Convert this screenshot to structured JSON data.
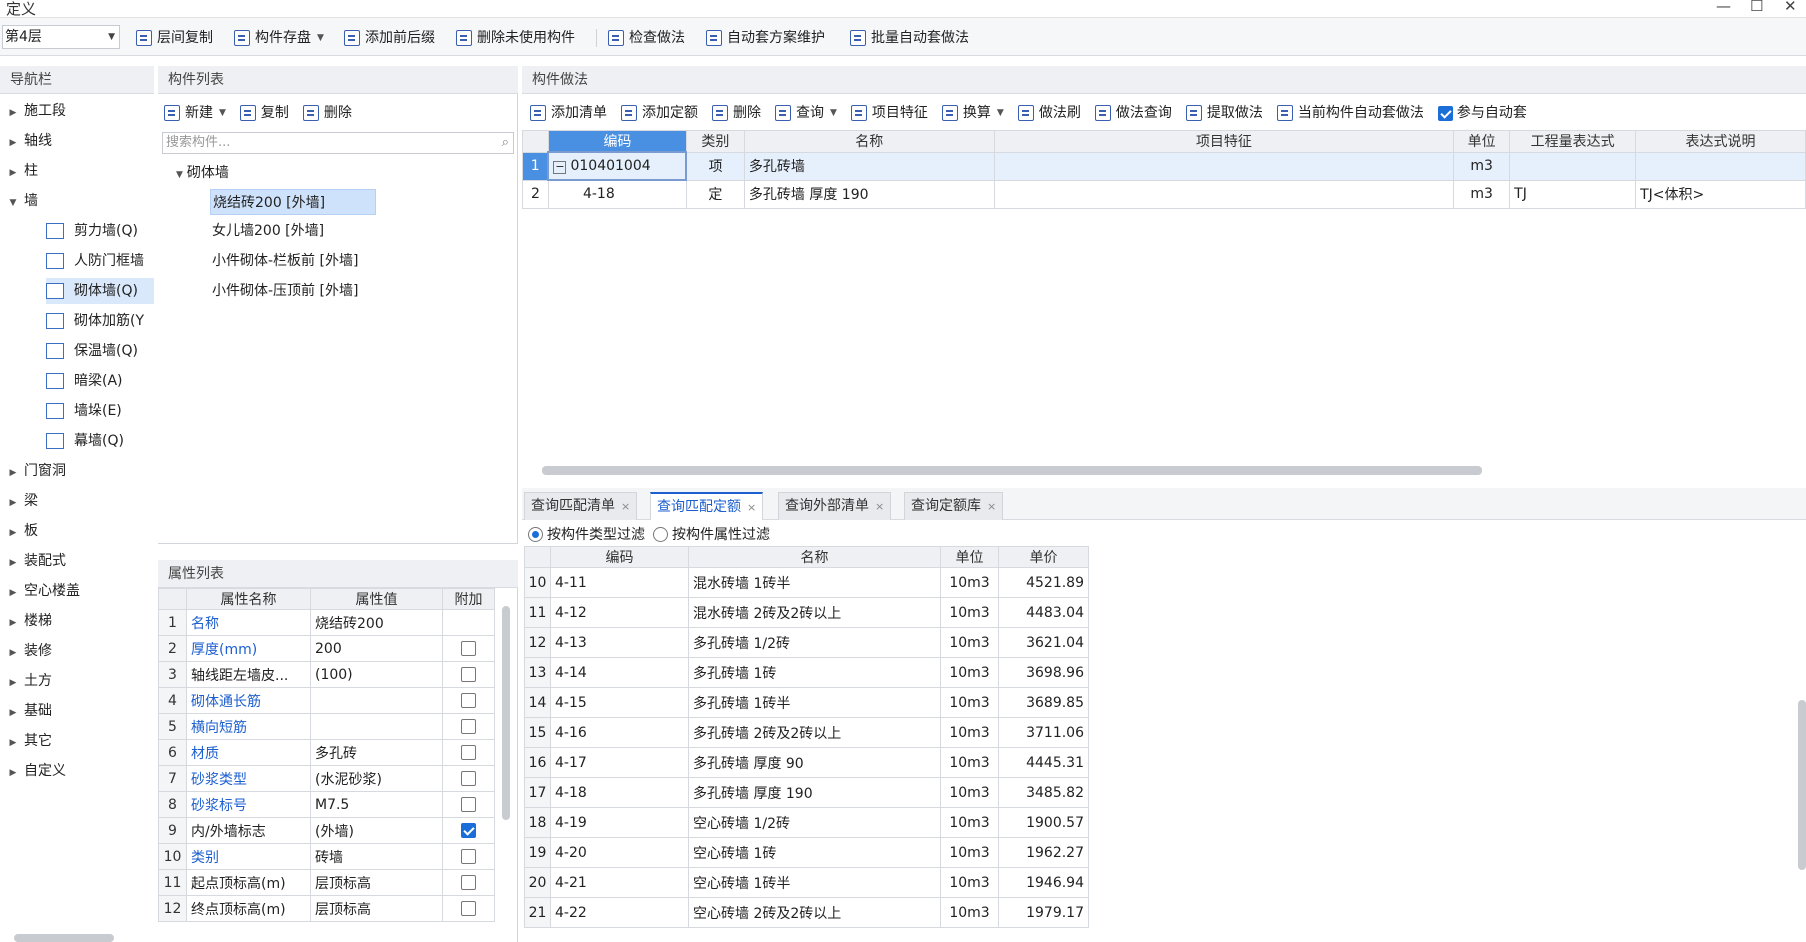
{
  "window": {
    "title": "定义",
    "min": "—",
    "max": "☐",
    "close": "✕"
  },
  "toolbar": {
    "layer": "第4层",
    "buttons": [
      "层间复制",
      "构件存盘",
      "添加前后缀",
      "删除未使用构件",
      "检查做法",
      "自动套方案维护",
      "批量自动套做法"
    ]
  },
  "nav": {
    "title": "导航栏",
    "top_items": [
      "施工段",
      "轴线",
      "柱",
      "墙"
    ],
    "wall_children": [
      "剪力墙(Q)",
      "人防门框墙",
      "砌体墙(Q)",
      "砌体加筋(Y",
      "保温墙(Q)",
      "暗梁(A)",
      "墙垛(E)",
      "幕墙(Q)"
    ],
    "bottom_items": [
      "门窗洞",
      "梁",
      "板",
      "装配式",
      "空心楼盖",
      "楼梯",
      "装修",
      "土方",
      "基础",
      "其它",
      "自定义"
    ]
  },
  "complist": {
    "title": "构件列表",
    "new_label": "新建",
    "copy_label": "复制",
    "delete_label": "删除",
    "search_placeholder": "搜索构件...",
    "group": "砌体墙",
    "items": [
      "烧结砖200 [外墙]",
      "女儿墙200 [外墙]",
      "小件砌体-栏板前 [外墙]",
      "小件砌体-压顶前 [外墙]"
    ]
  },
  "props": {
    "title": "属性列表",
    "headers": [
      "属性名称",
      "属性值",
      "附加"
    ],
    "rows": [
      {
        "n": "1",
        "name": "名称",
        "value": "烧结砖200",
        "blue": true,
        "cb": null
      },
      {
        "n": "2",
        "name": "厚度(mm)",
        "value": "200",
        "blue": true,
        "cb": false
      },
      {
        "n": "3",
        "name": "轴线距左墙皮...",
        "value": "(100)",
        "blue": false,
        "cb": false
      },
      {
        "n": "4",
        "name": "砌体通长筋",
        "value": "",
        "blue": true,
        "cb": false
      },
      {
        "n": "5",
        "name": "横向短筋",
        "value": "",
        "blue": true,
        "cb": false
      },
      {
        "n": "6",
        "name": "材质",
        "value": "多孔砖",
        "blue": true,
        "cb": false
      },
      {
        "n": "7",
        "name": "砂浆类型",
        "value": "(水泥砂浆)",
        "blue": true,
        "cb": false
      },
      {
        "n": "8",
        "name": "砂浆标号",
        "value": "M7.5",
        "blue": true,
        "cb": false
      },
      {
        "n": "9",
        "name": "内/外墙标志",
        "value": "(外墙)",
        "blue": false,
        "cb": true
      },
      {
        "n": "10",
        "name": "类别",
        "value": "砖墙",
        "blue": true,
        "cb": false
      },
      {
        "n": "11",
        "name": "起点顶标高(m)",
        "value": "层顶标高",
        "blue": false,
        "cb": false
      },
      {
        "n": "12",
        "name": "终点顶标高(m)",
        "value": "层顶标高",
        "blue": false,
        "cb": false
      }
    ]
  },
  "method": {
    "title": "构件做法",
    "buttons": [
      "添加清单",
      "添加定额",
      "删除",
      "查询",
      "项目特征",
      "换算",
      "做法刷",
      "做法查询",
      "提取做法",
      "当前构件自动套做法"
    ],
    "auto_label": "参与自动套",
    "headers": [
      "编码",
      "类别",
      "名称",
      "项目特征",
      "单位",
      "工程量表达式",
      "表达式说明"
    ],
    "rows": [
      {
        "n": "1",
        "code": "010401004",
        "type": "项",
        "name": "多孔砖墙",
        "feature": "",
        "unit": "m3",
        "expr": "",
        "desc": ""
      },
      {
        "n": "2",
        "code": "4-18",
        "type": "定",
        "name": "多孔砖墙 厚度 190",
        "feature": "",
        "unit": "m3",
        "expr": "TJ",
        "desc": "TJ<体积>"
      }
    ]
  },
  "query": {
    "tabs": [
      "查询匹配清单",
      "查询匹配定额",
      "查询外部清单",
      "查询定额库"
    ],
    "filter_type": "按构件类型过滤",
    "filter_attr": "按构件属性过滤",
    "headers": [
      "编码",
      "名称",
      "单位",
      "单价"
    ],
    "rows": [
      {
        "n": "10",
        "code": "4-11",
        "name": "混水砖墙 1砖半",
        "unit": "10m3",
        "price": "4521.89"
      },
      {
        "n": "11",
        "code": "4-12",
        "name": "混水砖墙 2砖及2砖以上",
        "unit": "10m3",
        "price": "4483.04"
      },
      {
        "n": "12",
        "code": "4-13",
        "name": "多孔砖墙 1/2砖",
        "unit": "10m3",
        "price": "3621.04"
      },
      {
        "n": "13",
        "code": "4-14",
        "name": "多孔砖墙 1砖",
        "unit": "10m3",
        "price": "3698.96"
      },
      {
        "n": "14",
        "code": "4-15",
        "name": "多孔砖墙 1砖半",
        "unit": "10m3",
        "price": "3689.85"
      },
      {
        "n": "15",
        "code": "4-16",
        "name": "多孔砖墙 2砖及2砖以上",
        "unit": "10m3",
        "price": "3711.06"
      },
      {
        "n": "16",
        "code": "4-17",
        "name": "多孔砖墙 厚度 90",
        "unit": "10m3",
        "price": "4445.31"
      },
      {
        "n": "17",
        "code": "4-18",
        "name": "多孔砖墙 厚度 190",
        "unit": "10m3",
        "price": "3485.82"
      },
      {
        "n": "18",
        "code": "4-19",
        "name": "空心砖墙 1/2砖",
        "unit": "10m3",
        "price": "1900.57"
      },
      {
        "n": "19",
        "code": "4-20",
        "name": "空心砖墙 1砖",
        "unit": "10m3",
        "price": "1962.27"
      },
      {
        "n": "20",
        "code": "4-21",
        "name": "空心砖墙 1砖半",
        "unit": "10m3",
        "price": "1946.94"
      },
      {
        "n": "21",
        "code": "4-22",
        "name": "空心砖墙 2砖及2砖以上",
        "unit": "10m3",
        "price": "1979.17"
      }
    ]
  }
}
